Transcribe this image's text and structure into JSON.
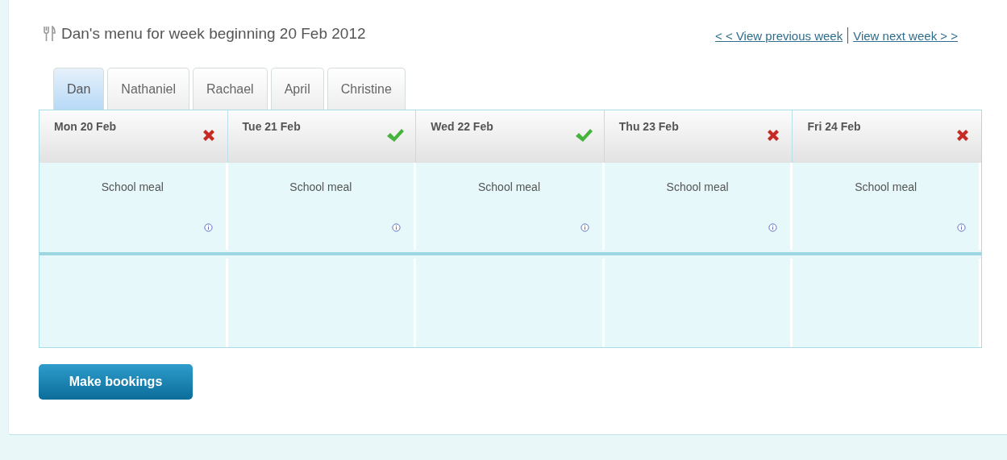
{
  "title": "Dan's menu for week beginning 20 Feb 2012",
  "nav": {
    "previous": "< < View previous week",
    "next": "View next week > >"
  },
  "tabs": [
    {
      "label": "Dan",
      "selected": true
    },
    {
      "label": "Nathaniel",
      "selected": false
    },
    {
      "label": "Rachael",
      "selected": false
    },
    {
      "label": "April",
      "selected": false
    },
    {
      "label": "Christine",
      "selected": false
    }
  ],
  "days": [
    {
      "date": "Mon 20 Feb",
      "booked": false,
      "meal": "School meal"
    },
    {
      "date": "Tue 21 Feb",
      "booked": true,
      "meal": "School meal"
    },
    {
      "date": "Wed 22 Feb",
      "booked": true,
      "meal": "School meal"
    },
    {
      "date": "Thu 23 Feb",
      "booked": false,
      "meal": "School meal"
    },
    {
      "date": "Fri 24 Feb",
      "booked": false,
      "meal": "School meal"
    }
  ],
  "button": "Make bookings"
}
